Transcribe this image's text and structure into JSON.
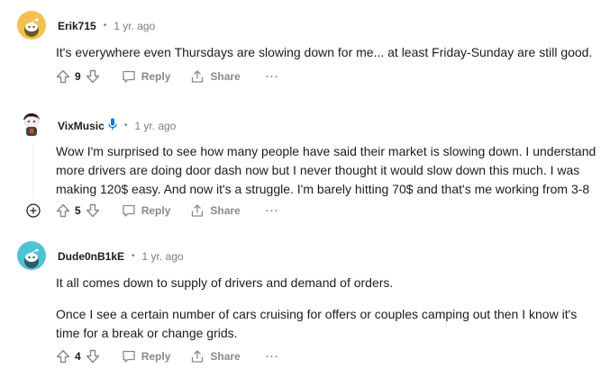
{
  "comments": [
    {
      "username": "Erik715",
      "separator": "•",
      "time": "1 yr. ago",
      "paragraphs": [
        "It's everywhere even Thursdays are slowing down for me... at least Friday-Sunday are still good."
      ],
      "score": "9",
      "avatar": "snoo-avatar-yellow",
      "has_mic": false
    },
    {
      "username": "VixMusic",
      "separator": "•",
      "time": "1 yr. ago",
      "paragraphs": [
        "Wow I'm surprised to see how many people have said their market is slowing down. I understand more drivers are doing door dash now but I never thought it would slow down this much. I was making 120$ easy. And now it's a struggle. I'm barely hitting 70$ and that's me working from 3-8"
      ],
      "score": "5",
      "avatar": "snoo-avatar-custom",
      "has_mic": true
    },
    {
      "username": "Dude0nB1kE",
      "separator": "•",
      "time": "1 yr. ago",
      "paragraphs": [
        "It all comes down to supply of drivers and demand of orders.",
        "Once I see a certain number of cars cruising for offers or couples camping out then I know it's time for a break or change grids."
      ],
      "score": "4",
      "avatar": "snoo-avatar-teal",
      "has_mic": false
    }
  ],
  "actions": {
    "reply_label": "Reply",
    "share_label": "Share",
    "more_label": "···"
  },
  "colors": {
    "text": "#1c1c1c",
    "muted": "#7c7c7c",
    "action": "#878a8c",
    "mic": "#0079d3",
    "avatar_yellow": "#f2c14e",
    "avatar_teal": "#4fc3d6"
  }
}
